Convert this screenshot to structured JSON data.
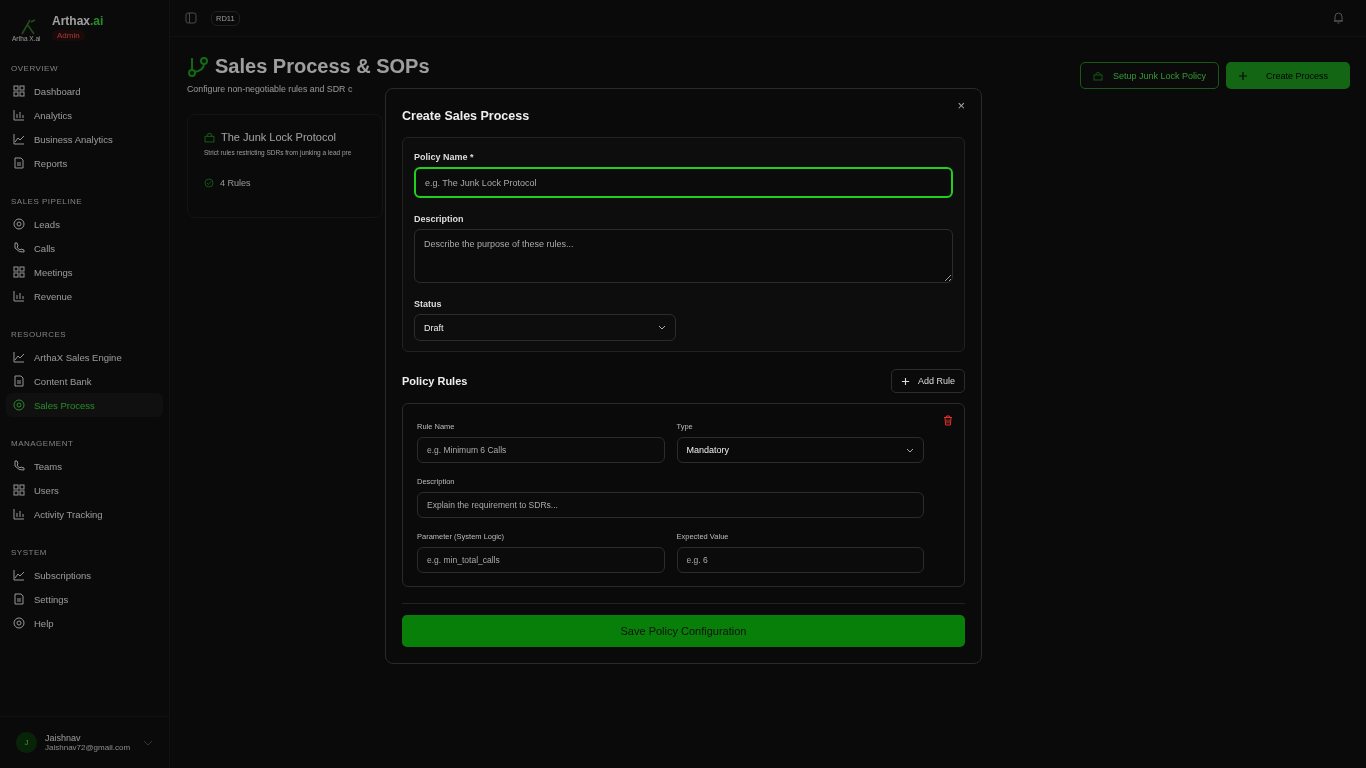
{
  "sidebar": {
    "brand_name": "Arthax",
    "brand_suffix": ".ai",
    "logo_caption": "Artha X.ai",
    "role_badge": "Admin",
    "sections": [
      {
        "title": "OVERVIEW",
        "items": [
          {
            "label": "Dashboard",
            "selected": false
          },
          {
            "label": "Analytics",
            "selected": false
          },
          {
            "label": "Business Analytics",
            "selected": false
          },
          {
            "label": "Reports",
            "selected": false
          }
        ]
      },
      {
        "title": "SALES PIPELINE",
        "items": [
          {
            "label": "Leads",
            "selected": false
          },
          {
            "label": "Calls",
            "selected": false
          },
          {
            "label": "Meetings",
            "selected": false
          },
          {
            "label": "Revenue",
            "selected": false
          }
        ]
      },
      {
        "title": "RESOURCES",
        "items": [
          {
            "label": "ArthaX Sales Engine",
            "selected": false
          },
          {
            "label": "Content Bank",
            "selected": false
          },
          {
            "label": "Sales Process",
            "selected": true
          }
        ]
      },
      {
        "title": "MANAGEMENT",
        "items": [
          {
            "label": "Teams",
            "selected": false
          },
          {
            "label": "Users",
            "selected": false
          },
          {
            "label": "Activity Tracking",
            "selected": false
          }
        ]
      },
      {
        "title": "SYSTEM",
        "items": [
          {
            "label": "Subscriptions",
            "selected": false
          },
          {
            "label": "Settings",
            "selected": false
          },
          {
            "label": "Help",
            "selected": false
          }
        ]
      }
    ],
    "user": {
      "initial": "J",
      "name": "Jaishnav",
      "email": "Jaishnav72@gmail.com"
    }
  },
  "topbar": {
    "badge": "RD11"
  },
  "page": {
    "title": "Sales Process & SOPs",
    "subtitle": "Configure non-negotiable rules and SDR c",
    "buttons": [
      {
        "label": "Setup Junk Lock Policy",
        "kind": "outline"
      },
      {
        "label": "Create Process",
        "kind": "primary"
      }
    ],
    "cards": [
      {
        "title": "The Junk Lock Protocol",
        "description": "Strict rules restricting SDRs from junking a lead pre",
        "rules": "4 Rules"
      }
    ]
  },
  "modal": {
    "title": "Create Sales Process",
    "close": "×",
    "policy_name": {
      "label": "Policy Name *",
      "placeholder": "e.g. The Junk Lock Protocol"
    },
    "description": {
      "label": "Description",
      "placeholder": "Describe the purpose of these rules..."
    },
    "status": {
      "label": "Status",
      "value": "Draft"
    },
    "rules_title": "Policy Rules",
    "add_rule": "Add Rule",
    "rules": [
      {
        "name": {
          "label": "Rule Name",
          "placeholder": "e.g. Minimum 6 Calls"
        },
        "type": {
          "label": "Type",
          "value": "Mandatory"
        },
        "description": {
          "label": "Description",
          "placeholder": "Explain the requirement to SDRs..."
        },
        "parameter": {
          "label": "Parameter (System Logic)",
          "placeholder": "e.g. min_total_calls"
        },
        "expected": {
          "label": "Expected Value",
          "placeholder": "e.g. 6"
        }
      }
    ],
    "save": "Save Policy Configuration"
  }
}
